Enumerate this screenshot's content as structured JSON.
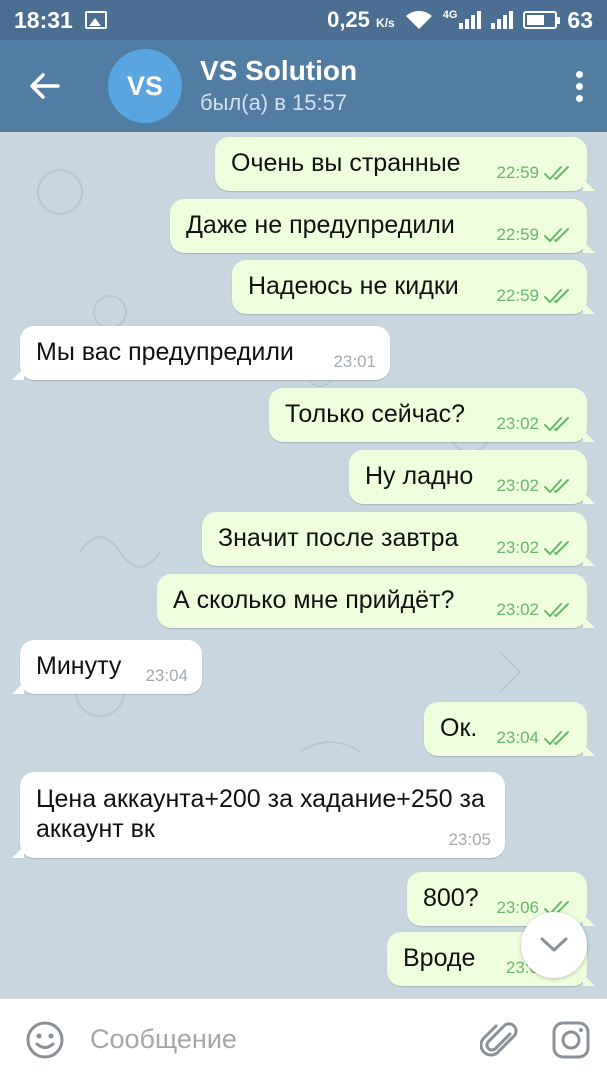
{
  "status_bar": {
    "time": "18:31",
    "speed": "0,25",
    "speed_unit": "K/s",
    "network": "4G",
    "battery": "63",
    "battery_fraction": 0.63
  },
  "header": {
    "avatar_initials": "VS",
    "title": "VS Solution",
    "subtitle": "был(а) в 15:57",
    "avatar_color": "#5aa5e0"
  },
  "messages": [
    {
      "dir": "out",
      "text": "Очень вы странные",
      "time": "22:59",
      "read": true
    },
    {
      "dir": "out",
      "text": "Даже не предупредили",
      "time": "22:59",
      "read": true
    },
    {
      "dir": "out",
      "text": "Надеюсь не кидки",
      "time": "22:59",
      "read": true
    },
    {
      "dir": "in",
      "text": "Мы вас предупредили",
      "time": "23:01"
    },
    {
      "dir": "out",
      "text": "Только сейчас?",
      "time": "23:02",
      "read": true
    },
    {
      "dir": "out",
      "text": "Ну ладно",
      "time": "23:02",
      "read": true
    },
    {
      "dir": "out",
      "text": "Значит после завтра",
      "time": "23:02",
      "read": true
    },
    {
      "dir": "out",
      "text": "А сколько мне прийдёт?",
      "time": "23:02",
      "read": true
    },
    {
      "dir": "in",
      "text": "Минуту",
      "time": "23:04"
    },
    {
      "dir": "out",
      "text": "Ок.",
      "time": "23:04",
      "read": true
    },
    {
      "dir": "in",
      "text": "Цена аккаунта+200 за хадание+250 за аккаунт вк",
      "time": "23:05"
    },
    {
      "dir": "out",
      "text": "800?",
      "time": "23:06",
      "read": true
    },
    {
      "dir": "out",
      "text": "Вроде",
      "time": "23:0",
      "read": true
    }
  ],
  "input": {
    "placeholder": "Сообщение"
  },
  "icons": {
    "back": "arrow-left-icon",
    "menu": "more-vertical-icon",
    "emoji": "smile-icon",
    "attach": "paperclip-icon",
    "camera": "camera-icon",
    "scroll": "chevron-down-icon"
  },
  "colors": {
    "header": "#527da3",
    "status_bar": "#4a6f92",
    "outgoing_bubble": "#effedd",
    "incoming_bubble": "#ffffff",
    "check": "#6ab76c"
  }
}
